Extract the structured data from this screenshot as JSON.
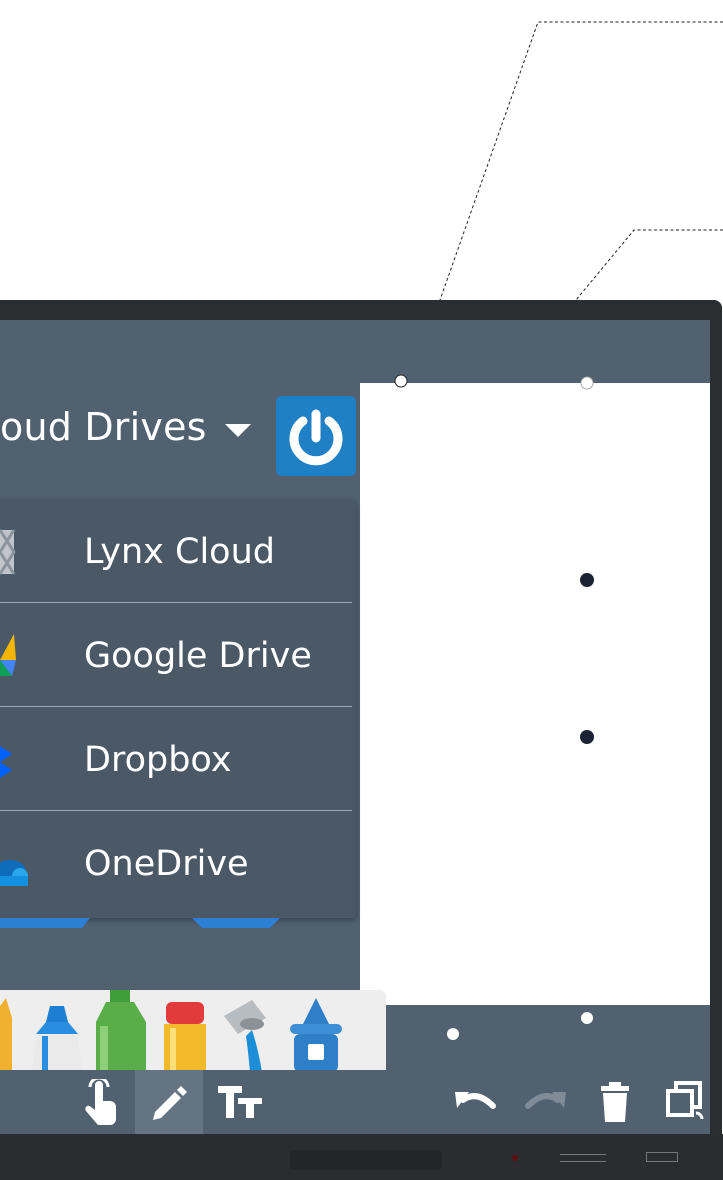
{
  "header": {
    "title": "oud Drives",
    "dropdown_icon": "caret-down-icon",
    "power_icon": "power-icon"
  },
  "drive_menu": {
    "items": [
      {
        "label": "Lynx Cloud",
        "icon": "lynx-cloud-icon"
      },
      {
        "label": "Google Drive",
        "icon": "google-drive-icon"
      },
      {
        "label": "Dropbox",
        "icon": "dropbox-icon"
      },
      {
        "label": "OneDrive",
        "icon": "onedrive-icon"
      }
    ]
  },
  "marker_tray": {
    "tools": [
      "highlighter-icon",
      "blue-marker-icon",
      "green-marker-icon",
      "red-yellow-marker-icon",
      "paint-bucket-icon",
      "shape-stamp-icon"
    ]
  },
  "toolbar": {
    "tools": [
      "touch-icon",
      "pen-icon",
      "text-icon",
      "undo-icon",
      "redo-icon",
      "trash-icon",
      "copy-page-icon"
    ],
    "active_tool": "pen-icon"
  },
  "colors": {
    "screen_bg": "#516170",
    "menu_bg": "#4b5966",
    "power_accent": "#1f80c5",
    "bezel": "#2b2e31"
  }
}
